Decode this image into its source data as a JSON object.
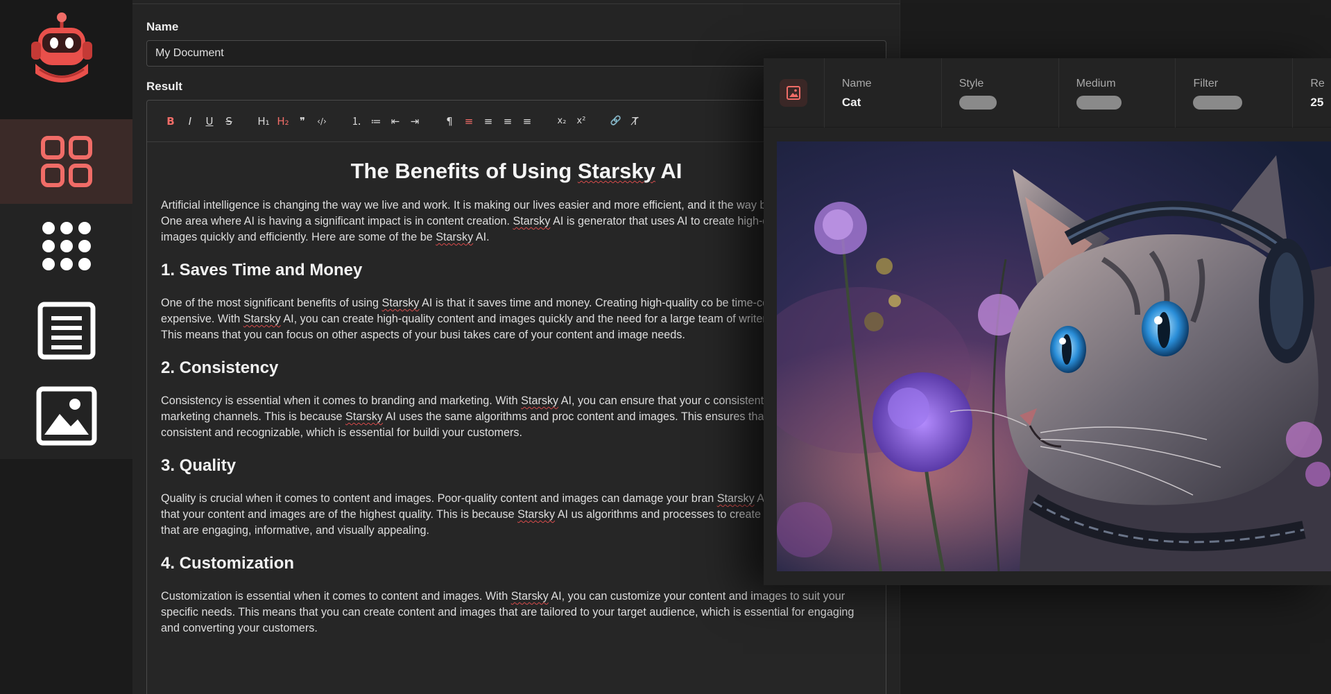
{
  "form": {
    "name_label": "Name",
    "name_value": "My Document",
    "result_label": "Result"
  },
  "toolbar": {
    "bold": "B",
    "italic": "I",
    "underline": "U",
    "strike": "S",
    "h1": "H₁",
    "h2": "H₂",
    "quote": "❞",
    "code": "‹/›",
    "ordered_list": "⒈",
    "bullet_list": "≔",
    "outdent": "⇤",
    "indent": "⇥",
    "rtl": "¶",
    "align_left": "≡",
    "align_center": "≡",
    "align_right": "≡",
    "justify": "≡",
    "subscript": "x₂",
    "superscript": "x²",
    "link": "🔗",
    "clear_format": "T̸"
  },
  "document": {
    "title": "The Benefits of Using Starsky AI",
    "intro": "Artificial intelligence is changing the way we live and work. It is making our lives easier and more efficient, and it the way businesses operate. One area where AI is having a significant impact is in content creation. Starsky AI is generator that uses AI to create high-quality content and images quickly and efficiently. Here are some of the be Starsky AI.",
    "sections": [
      {
        "heading": "1. Saves Time and Money",
        "body": "One of the most significant benefits of using Starsky AI is that it saves time and money. Creating high-quality co be time-consuming and expensive. With Starsky AI, you can create high-quality content and images quickly and the need for a large team of writers and designers. This means that you can focus on other aspects of your busi takes care of your content and image needs."
      },
      {
        "heading": "2. Consistency",
        "body": "Consistency is essential when it comes to branding and marketing. With Starsky AI, you can ensure that your c consistent across all your marketing channels. This is because Starsky AI uses the same algorithms and proc content and images. This ensures that your brand is consistent and recognizable, which is essential for buildi your customers."
      },
      {
        "heading": "3. Quality",
        "body": "Quality is crucial when it comes to content and images. Poor-quality content and images can damage your bran Starsky AI, you can be sure that your content and images are of the highest quality. This is because Starsky AI us algorithms and processes to create content and images that are engaging, informative, and visually appealing."
      },
      {
        "heading": "4. Customization",
        "body": "Customization is essential when it comes to content and images. With Starsky AI, you can customize your content and images to suit your specific needs. This means that you can create content and images that are tailored to your target audience, which is essential for engaging and converting your customers."
      }
    ]
  },
  "image_card": {
    "columns": [
      {
        "key": "Name",
        "value": "Cat"
      },
      {
        "key": "Style",
        "value": ""
      },
      {
        "key": "Medium",
        "value": ""
      },
      {
        "key": "Filter",
        "value": ""
      },
      {
        "key": "Re",
        "value": "25"
      }
    ]
  },
  "colors": {
    "accent": "#f06c67",
    "active_nav_bg": "#3b2a28",
    "panel_bg": "#242424"
  },
  "icons": {
    "logo": "robot-logo",
    "nav": [
      "dashboard-grid-icon",
      "apps-dots-icon",
      "document-icon",
      "image-icon"
    ],
    "card": "image-icon"
  }
}
